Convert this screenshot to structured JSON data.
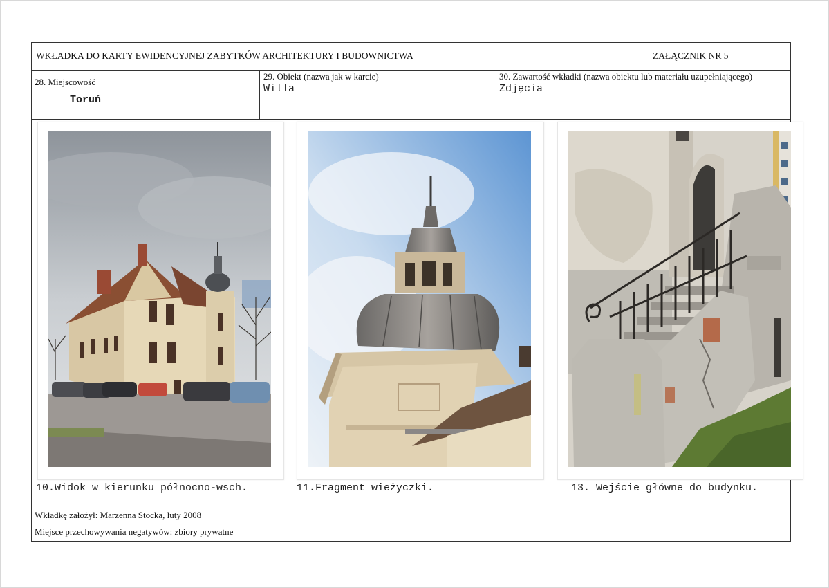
{
  "header": {
    "title": "WKŁADKA DO KARTY EWIDENCYJNEJ ZABYTKÓW ARCHITEKTURY I BUDOWNICTWA",
    "attachment": "ZAŁĄCZNIK NR 5"
  },
  "fields": {
    "locality_label": "28. Miejscowość",
    "locality_value": "Toruń",
    "object_label": "29. Obiekt (nazwa jak w karcie)",
    "object_value": "Willa",
    "content_label": "30. Zawartość wkładki (nazwa obiektu lub materiału uzupełniającego)",
    "content_value": "Zdjęcia"
  },
  "photos": [
    {
      "caption": "10.Widok w kierunku północno-wsch."
    },
    {
      "caption": "11.Fragment wieżyczki."
    },
    {
      "caption": "13.  Wejście główne do budynku."
    }
  ],
  "footer": {
    "founder": "Wkładkę założył:  Marzenna Stocka, luty 2008",
    "storage": "Miejsce przechowywania negatywów: zbiory prywatne"
  }
}
